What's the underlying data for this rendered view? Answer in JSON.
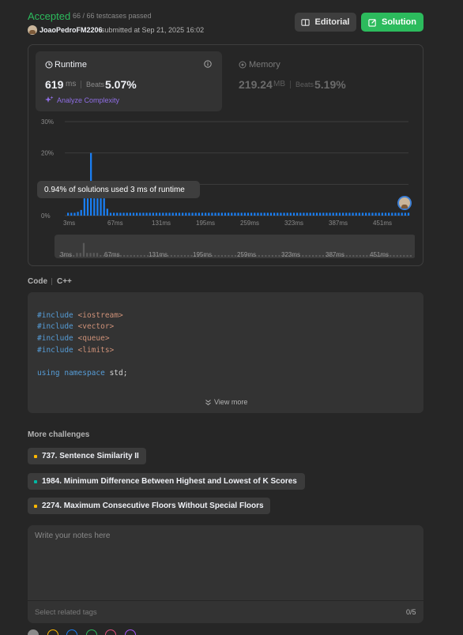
{
  "header": {
    "status": "Accepted",
    "testcases": "66 / 66 testcases passed",
    "submitter": "JoaoPedroFM2206",
    "submitted_at": "submitted at Sep 21, 2025 16:02",
    "editorial_label": "Editorial",
    "solution_label": "Solution"
  },
  "runtime": {
    "label": "Runtime",
    "value": "619",
    "unit": "ms",
    "beats_label": "Beats",
    "beats_value": "5.07%",
    "analyze_label": "Analyze Complexity"
  },
  "memory": {
    "label": "Memory",
    "value": "219.24",
    "unit": "MB",
    "beats_label": "Beats",
    "beats_value": "5.19%"
  },
  "tooltip": "0.94% of solutions used 3 ms of runtime",
  "chart_data": {
    "type": "bar",
    "y_ticks": [
      "30%",
      "20%",
      "10%",
      "0%"
    ],
    "ylim": [
      0,
      30
    ],
    "x_tick_labels": [
      "3ms",
      "67ms",
      "131ms",
      "195ms",
      "259ms",
      "323ms",
      "387ms",
      "451ms"
    ],
    "values": [
      0.9,
      0.9,
      0.9,
      1.2,
      1.8,
      5.5,
      5.5,
      20,
      5.5,
      5.5,
      5.5,
      5.5,
      2.2,
      0.9,
      0.9,
      0.9,
      0.9,
      0.9,
      0.9,
      0.9,
      0.9,
      0.9,
      0.9,
      0.9,
      0.9,
      0.9,
      0.9,
      0.9,
      0.9,
      0.9,
      0.9,
      0.9,
      0.9,
      0.9,
      0.9,
      0.9,
      0.9,
      0.9,
      0.9,
      0.9,
      0.9,
      0.9,
      0.9,
      0.9,
      0.9,
      0.9,
      0.9,
      0.9,
      0.9,
      0.9,
      0.9,
      0.9,
      0.9,
      0.9,
      0.9,
      0.9,
      0.9,
      0.9,
      0.9,
      0.9,
      0.9,
      0.9,
      0.9,
      0.9,
      0.9,
      0.9,
      0.9,
      0.9,
      0.9,
      0.9,
      0.9,
      0.9,
      0.9,
      0.9,
      0.9,
      0.9,
      0.9,
      0.9,
      0.9,
      0.9,
      0.9,
      0.9,
      0.9,
      0.9,
      0.9,
      0.9,
      0.9,
      0.9,
      0.9,
      0.9,
      0.9,
      0.9,
      0.9,
      0.9,
      0.9,
      0.9,
      0.9,
      0.9,
      0.9,
      0.9,
      0.9,
      0.9,
      0.9,
      0.9,
      0.9
    ],
    "bar_color": "#1a7ef2",
    "grid": true
  },
  "code": {
    "label": "Code",
    "language": "C++",
    "lines": [
      "#include <iostream>",
      "#include <vector>",
      "#include <queue>",
      "#include <limits>",
      "",
      "using namespace std;"
    ],
    "view_more": "View more"
  },
  "more_challenges": {
    "title": "More challenges",
    "items": [
      {
        "label": "737. Sentence Similarity II",
        "color": "#ffb800"
      },
      {
        "label": "1984. Minimum Difference Between Highest and Lowest of K Scores",
        "color": "#00b8a3"
      },
      {
        "label": "2274. Maximum Consecutive Floors Without Special Floors",
        "color": "#ffb800"
      }
    ]
  },
  "notes": {
    "placeholder": "Write your notes here",
    "tags_placeholder": "Select related tags",
    "tags_count": "0/5"
  },
  "note_colors": [
    "#8a8a8a",
    "#ffb800",
    "#1a7ef2",
    "#2cbb5d",
    "#e04f7d",
    "#a855f7"
  ]
}
